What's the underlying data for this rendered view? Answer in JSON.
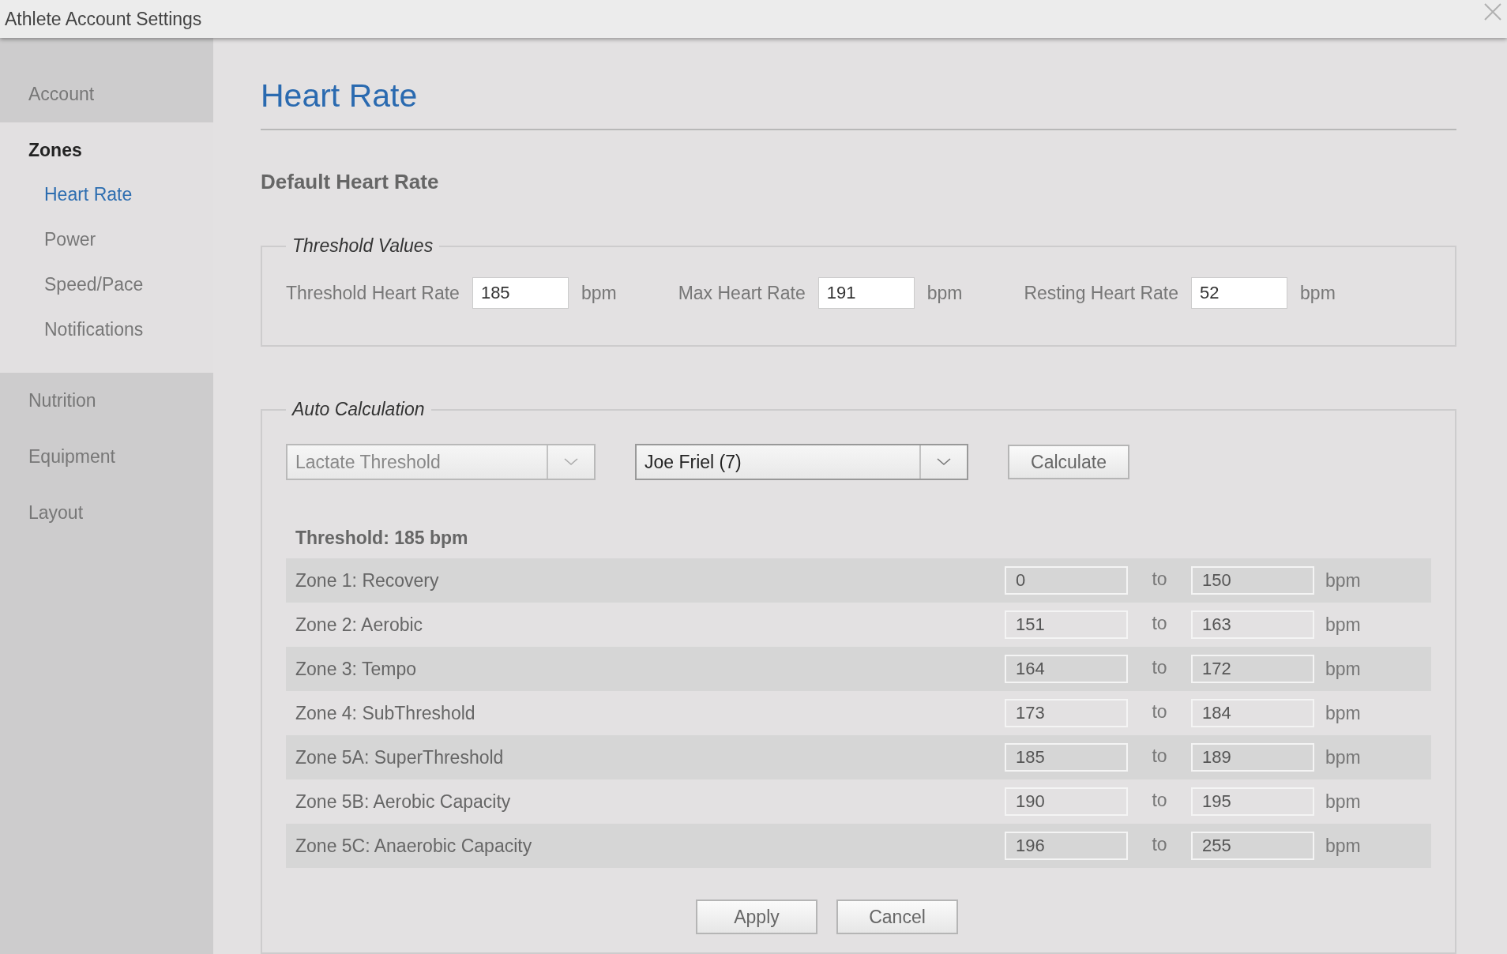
{
  "window": {
    "title": "Athlete Account Settings"
  },
  "sidebar": {
    "items": [
      {
        "label": "Account",
        "expanded": false,
        "selected": false
      },
      {
        "label": "Zones",
        "expanded": true,
        "selected": true,
        "children": [
          {
            "label": "Heart Rate",
            "selected": true
          },
          {
            "label": "Power",
            "selected": false
          },
          {
            "label": "Speed/Pace",
            "selected": false
          },
          {
            "label": "Notifications",
            "selected": false
          }
        ]
      },
      {
        "label": "Nutrition",
        "expanded": false,
        "selected": false
      },
      {
        "label": "Equipment",
        "expanded": false,
        "selected": false
      },
      {
        "label": "Layout",
        "expanded": false,
        "selected": false
      }
    ]
  },
  "page": {
    "title": "Heart Rate",
    "section_title": "Default Heart Rate"
  },
  "threshold_values": {
    "legend": "Threshold Values",
    "fields": [
      {
        "label": "Threshold Heart Rate",
        "value": "185",
        "unit": "bpm"
      },
      {
        "label": "Max Heart Rate",
        "value": "191",
        "unit": "bpm"
      },
      {
        "label": "Resting Heart Rate",
        "value": "52",
        "unit": "bpm"
      }
    ]
  },
  "auto_calculation": {
    "legend": "Auto Calculation",
    "selects": [
      {
        "value": "Lactate Threshold",
        "disabled": true
      },
      {
        "value": "Joe Friel (7)",
        "disabled": false
      }
    ],
    "calculate_button": "Calculate",
    "threshold_label": "Threshold: 185 bpm",
    "zones": [
      {
        "name": "Zone 1: Recovery",
        "from": "0",
        "separator": "to",
        "to": "150",
        "unit": "bpm"
      },
      {
        "name": "Zone 2: Aerobic",
        "from": "151",
        "separator": "to",
        "to": "163",
        "unit": "bpm"
      },
      {
        "name": "Zone 3: Tempo",
        "from": "164",
        "separator": "to",
        "to": "172",
        "unit": "bpm"
      },
      {
        "name": "Zone 4: SubThreshold",
        "from": "173",
        "separator": "to",
        "to": "184",
        "unit": "bpm"
      },
      {
        "name": "Zone 5A: SuperThreshold",
        "from": "185",
        "separator": "to",
        "to": "189",
        "unit": "bpm"
      },
      {
        "name": "Zone 5B: Aerobic Capacity",
        "from": "190",
        "separator": "to",
        "to": "195",
        "unit": "bpm"
      },
      {
        "name": "Zone 5C: Anaerobic Capacity",
        "from": "196",
        "separator": "to",
        "to": "255",
        "unit": "bpm"
      }
    ]
  },
  "buttons": [
    "Apply",
    "Cancel"
  ]
}
